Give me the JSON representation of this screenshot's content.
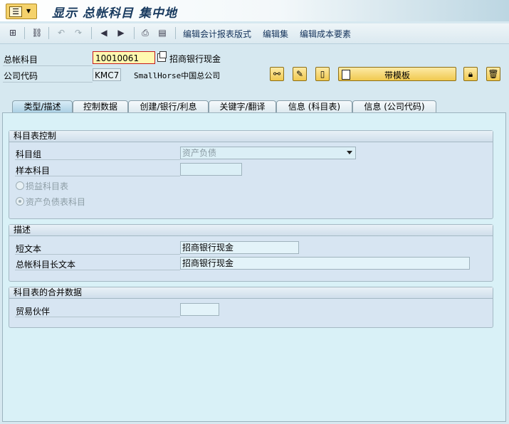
{
  "window": {
    "title": "显示 总帐科目 集中地"
  },
  "toolbar": {
    "links": [
      "编辑会计报表版式",
      "编辑集",
      "编辑成本要素"
    ]
  },
  "header": {
    "account_label": "总帐科目",
    "account_value": "10010061",
    "account_desc": "招商银行现金",
    "company_label": "公司代码",
    "company_value": "KMC7",
    "company_desc": "SmallHorse中国总公司",
    "template_button": "带模板"
  },
  "tabs": [
    "类型/描述",
    "控制数据",
    "创建/银行/利息",
    "关键字/翻译",
    "信息 (科目表)",
    "信息 (公司代码)"
  ],
  "groups": {
    "coa_control": {
      "title": "科目表控制",
      "account_group_label": "科目组",
      "account_group_value": "资产负债",
      "sample_account_label": "样本科目",
      "sample_account_value": "",
      "radio_pl": "损益科目表",
      "radio_bs": "资产负债表科目"
    },
    "description": {
      "title": "描述",
      "short_text_label": "短文本",
      "short_text_value": "招商银行现金",
      "long_text_label": "总帐科目长文本",
      "long_text_value": "招商银行现金"
    },
    "consolidation": {
      "title": "科目表的合并数据",
      "partner_label": "贸易伙伴",
      "partner_value": ""
    }
  }
}
